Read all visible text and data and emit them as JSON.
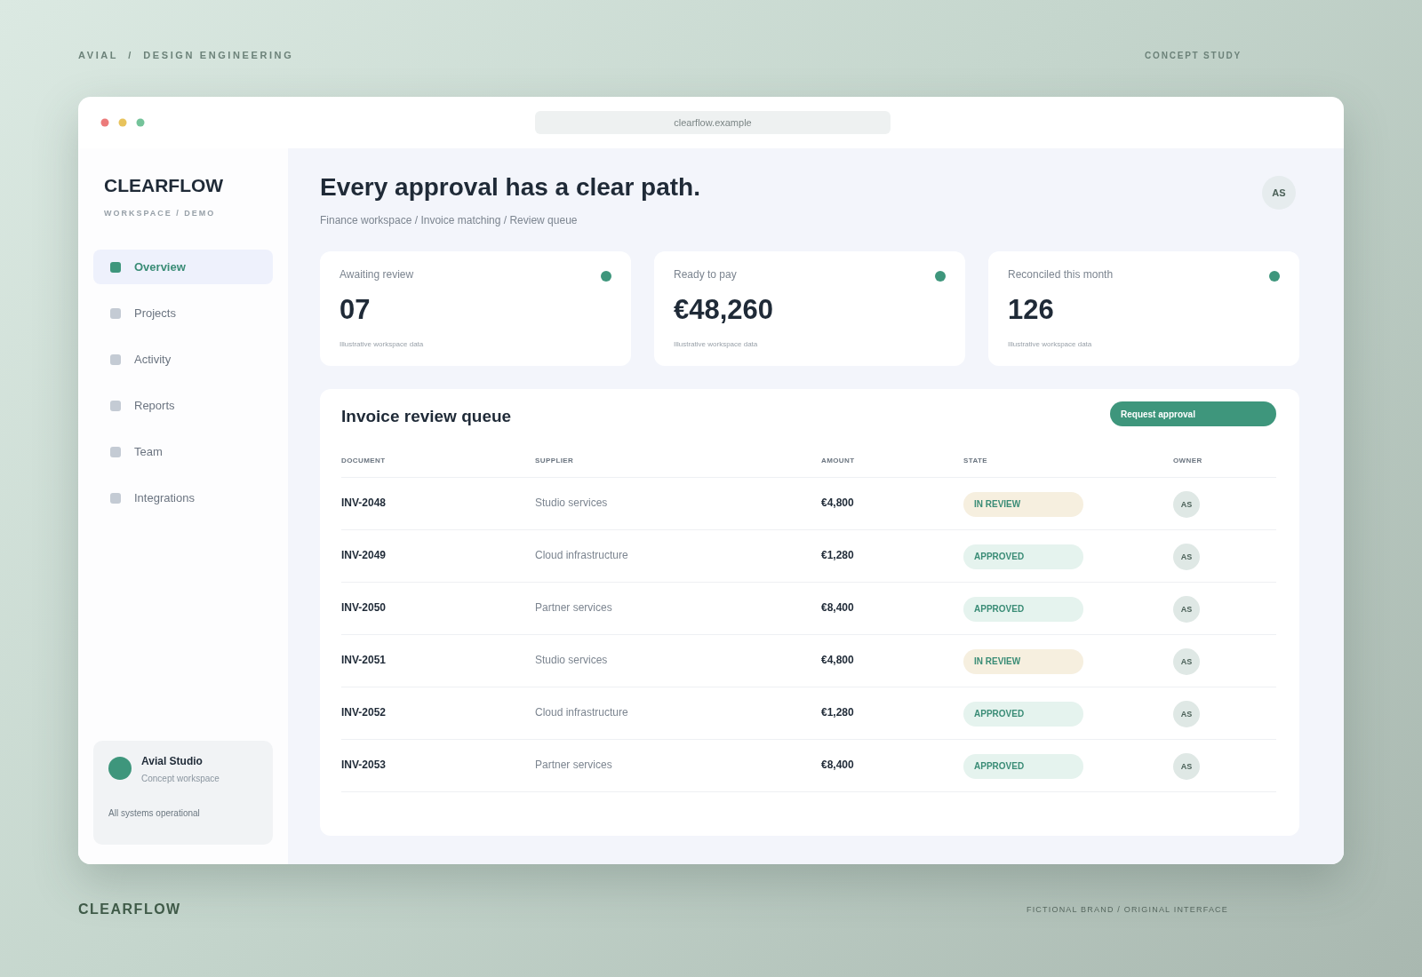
{
  "page_header": {
    "left": "AVIAL  /  DESIGN ENGINEERING",
    "right": "CONCEPT STUDY"
  },
  "window": {
    "address": "clearflow.example"
  },
  "sidebar": {
    "brand": "CLEARFLOW",
    "subtitle": "WORKSPACE / DEMO",
    "items": [
      {
        "label": "Overview",
        "selected": true
      },
      {
        "label": "Projects",
        "selected": false
      },
      {
        "label": "Activity",
        "selected": false
      },
      {
        "label": "Reports",
        "selected": false
      },
      {
        "label": "Team",
        "selected": false
      },
      {
        "label": "Integrations",
        "selected": false
      }
    ],
    "workspace_card": {
      "name": "Avial Studio",
      "description": "Concept workspace",
      "status": "All systems operational"
    }
  },
  "main": {
    "title": "Every approval has a clear path.",
    "breadcrumb": "Finance workspace / Invoice matching / Review queue",
    "avatar": "AS",
    "stats": [
      {
        "label": "Awaiting review",
        "value": "07",
        "note": "Illustrative workspace data"
      },
      {
        "label": "Ready to pay",
        "value": "€48,260",
        "note": "Illustrative workspace data"
      },
      {
        "label": "Reconciled this month",
        "value": "126",
        "note": "Illustrative workspace data"
      }
    ],
    "queue": {
      "title": "Invoice review queue",
      "action": "Request approval",
      "columns": [
        "DOCUMENT",
        "SUPPLIER",
        "AMOUNT",
        "STATE",
        "OWNER"
      ],
      "rows": [
        {
          "document": "INV-2048",
          "supplier": "Studio services",
          "amount": "€4,800",
          "state": "IN REVIEW",
          "kind": "review",
          "owner": "AS"
        },
        {
          "document": "INV-2049",
          "supplier": "Cloud infrastructure",
          "amount": "€1,280",
          "state": "APPROVED",
          "kind": "approved",
          "owner": "AS"
        },
        {
          "document": "INV-2050",
          "supplier": "Partner services",
          "amount": "€8,400",
          "state": "APPROVED",
          "kind": "approved",
          "owner": "AS"
        },
        {
          "document": "INV-2051",
          "supplier": "Studio services",
          "amount": "€4,800",
          "state": "IN REVIEW",
          "kind": "review",
          "owner": "AS"
        },
        {
          "document": "INV-2052",
          "supplier": "Cloud infrastructure",
          "amount": "€1,280",
          "state": "APPROVED",
          "kind": "approved",
          "owner": "AS"
        },
        {
          "document": "INV-2053",
          "supplier": "Partner services",
          "amount": "€8,400",
          "state": "APPROVED",
          "kind": "approved",
          "owner": "AS"
        }
      ]
    }
  },
  "footer": {
    "left": "CLEARFLOW",
    "right": "FICTIONAL BRAND / ORIGINAL INTERFACE"
  }
}
